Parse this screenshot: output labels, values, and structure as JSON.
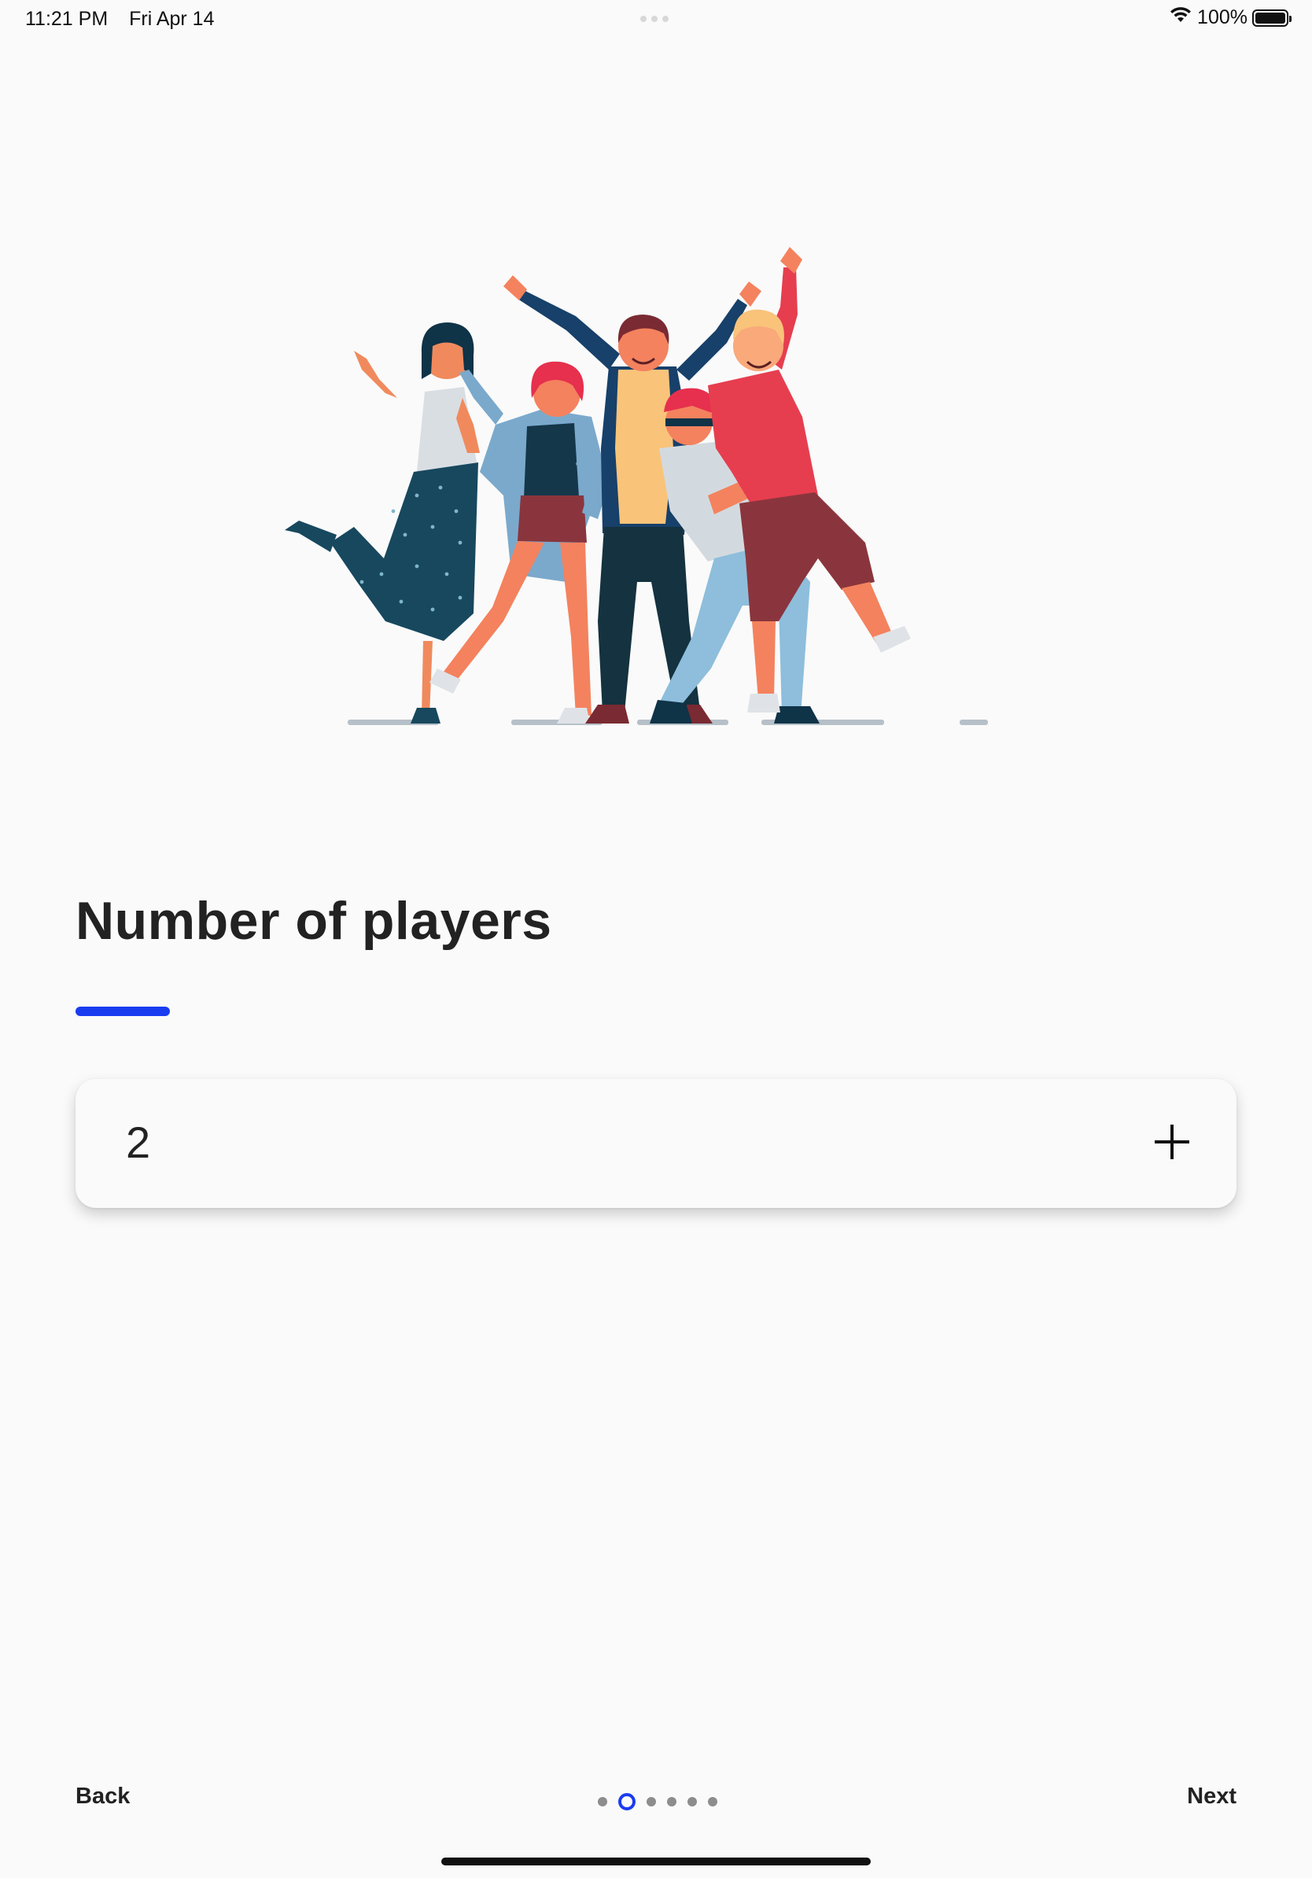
{
  "status_bar": {
    "time": "11:21 PM",
    "date": "Fri Apr 14",
    "battery_percent": "100%",
    "battery_level": 1.0,
    "icons": [
      "wifi-icon",
      "battery-icon"
    ]
  },
  "illustration": {
    "alt": "group-of-friends-celebrating"
  },
  "title": "Number of players",
  "stepper": {
    "value": "2",
    "increment_icon": "plus-icon"
  },
  "navigation": {
    "back_label": "Back",
    "next_label": "Next",
    "page_count": 6,
    "current_page": 2
  },
  "colors": {
    "accent": "#1a3cf0",
    "background": "#fafafa",
    "text": "#222222"
  }
}
